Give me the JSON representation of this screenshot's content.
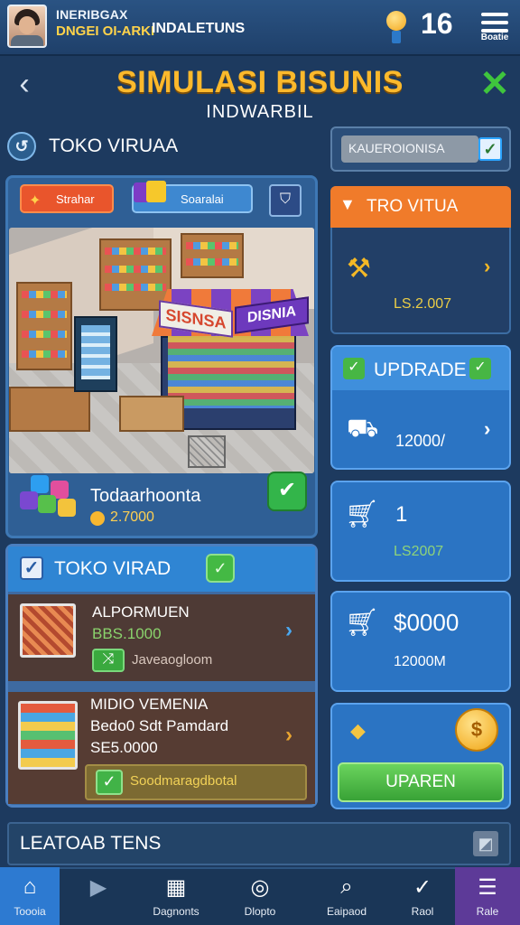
{
  "header": {
    "player_name": "INERIBGAX",
    "player_title": "DNGEI OI-ARKI",
    "player_subtitle": "INDALETUNS",
    "level_value": "16",
    "menu_label": "Boatie"
  },
  "title": {
    "main": "SIMULASI BISUNIS",
    "subtitle": "INDWARBIL"
  },
  "store": {
    "name": "TOKO VIRUAA",
    "tag_strategi": "Strahar",
    "tag_sosial": "Soaralai",
    "sign_left": "SISNSA",
    "sign_right": "DISNIA",
    "label": "Todaarhoonta",
    "value": "2.7000"
  },
  "toko_vira": {
    "title": "TOKO VIRAD",
    "items": [
      {
        "title": "ALPORMUEN",
        "price": "BBS.1000",
        "note": "Javeaogloom"
      },
      {
        "title": "MIDIO VEMENIA",
        "desc": "Bedo0 Sdt Pamdard",
        "price": "SE5.0000",
        "bar_label": "Soodmaragdbotal"
      }
    ]
  },
  "right": {
    "search_value": "KAUEROIONISA",
    "toko_title": "TRO VITUA",
    "toko_value": "LS.2.007",
    "upgrade_title": "UPDRADE",
    "upgrade_value": "12000/",
    "qty_value": "1",
    "qty_sub": "LS2007",
    "money_value": "$0000",
    "money_sub": "12000M",
    "upgrade_button": "UPAREN"
  },
  "leaderboard": {
    "label": "LEATOAB TENS"
  },
  "nav": {
    "home": "Toooia",
    "shop": "Dagnonts",
    "map": "Dlopto",
    "stats": "Eaipaod",
    "goals": "Raol",
    "more": "Rale"
  },
  "colors": {
    "accent_orange": "#f07b2a",
    "accent_gold": "#fbb92c",
    "accent_green": "#3fc53d",
    "accent_blue": "#2b74c3",
    "background": "#1d3a5f"
  },
  "icons": {
    "back": "chevron-left-icon",
    "close": "close-x-icon",
    "store": "refresh-icon",
    "cart": "shopping-cart-icon",
    "coin": "coin-icon",
    "menu": "hamburger-icon"
  }
}
